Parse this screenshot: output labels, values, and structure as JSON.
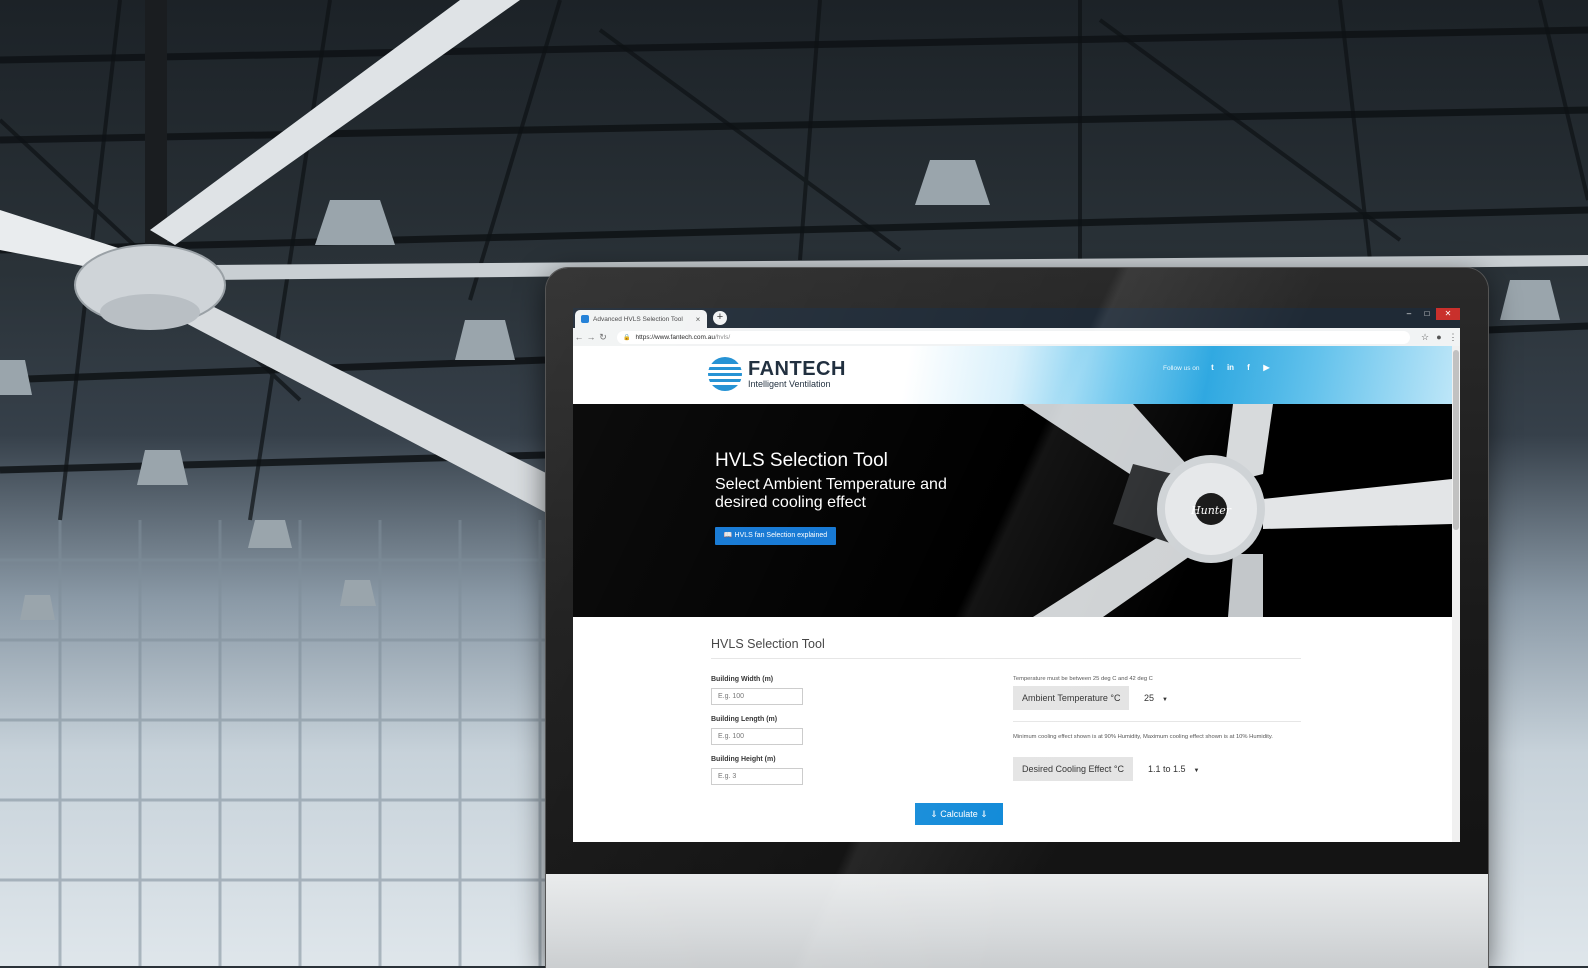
{
  "browser": {
    "tab_title": "Advanced HVLS Selection Tool",
    "tab_close": "×",
    "new_tab": "+",
    "url_host": "https://www.fantech.com.au",
    "url_path": "/hvls/"
  },
  "header": {
    "logo_name": "FANTECH",
    "logo_tagline": "Intelligent Ventilation",
    "follow_label": "Follow us on",
    "social": [
      "t",
      "in",
      "f",
      "▶"
    ]
  },
  "hero": {
    "title": "HVLS Selection Tool",
    "subtitle": "Select Ambient Temperature and desired cooling effect",
    "button": "📖 HVLS fan Selection explained",
    "fan_logo": "Hunter"
  },
  "form": {
    "title": "HVLS Selection Tool",
    "width_label": "Building Width (m)",
    "width_placeholder": "E.g. 100",
    "length_label": "Building Length (m)",
    "length_placeholder": "E.g. 100",
    "height_label": "Building Height (m)",
    "height_placeholder": "E.g. 3",
    "temp_note": "Temperature must be between 25 deg C and 42 deg C",
    "temp_label": "Ambient Temperature °C",
    "temp_value": "25",
    "cooling_note": "Minimum cooling effect shown is at 90% Humidity, Maximum cooling effect shown is at 10% Humidity.",
    "cooling_label": "Desired Cooling Effect °C",
    "cooling_value": "1.1 to 1.5",
    "calculate": "⇓ Calculate ⇓"
  },
  "colors": {
    "accent": "#0d88d8",
    "hero_button": "#1478d4",
    "header_blue": "#2aa6e0",
    "browser_frame": "#1f2a36"
  }
}
